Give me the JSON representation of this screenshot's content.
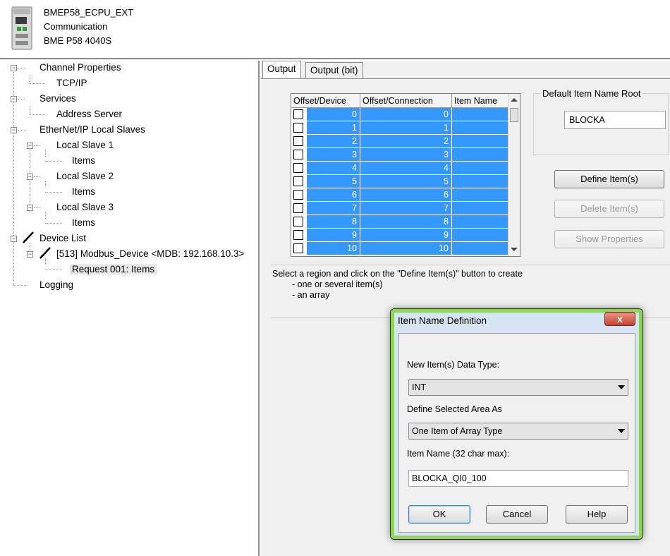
{
  "header": {
    "device_name": "BMEP58_ECPU_EXT",
    "category": "Communication",
    "model": "BME P58 4040S"
  },
  "tree": {
    "channel_properties": "Channel Properties",
    "tcpip": "TCP/IP",
    "services": "Services",
    "address_server": "Address Server",
    "local_slaves": "EtherNet/IP Local Slaves",
    "local_slave_1": "Local Slave 1",
    "local_slave_2": "Local Slave 2",
    "local_slave_3": "Local Slave 3",
    "items": "Items",
    "device_list": "Device List",
    "modbus_device": "[513] Modbus_Device <MDB: 192.168.10.3>",
    "request": "Request 001: Items",
    "logging": "Logging",
    "expand_glyph": "−"
  },
  "tabs": [
    "Output",
    "Output (bit)"
  ],
  "grid": {
    "columns": [
      "Offset/Device",
      "Offset/Connection",
      "Item Name"
    ],
    "rows": [
      {
        "device": "0",
        "connection": "0"
      },
      {
        "device": "1",
        "connection": "1"
      },
      {
        "device": "2",
        "connection": "2"
      },
      {
        "device": "3",
        "connection": "3"
      },
      {
        "device": "4",
        "connection": "4"
      },
      {
        "device": "5",
        "connection": "5"
      },
      {
        "device": "6",
        "connection": "6"
      },
      {
        "device": "7",
        "connection": "7"
      },
      {
        "device": "8",
        "connection": "8"
      },
      {
        "device": "9",
        "connection": "9"
      },
      {
        "device": "10",
        "connection": "10"
      }
    ],
    "selection_color": "#3399ff"
  },
  "root": {
    "label": "Default Item Name Root",
    "value": "BLOCKA"
  },
  "buttons": {
    "define": "Define Item(s)",
    "delete": "Delete Item(s)",
    "show_properties": "Show Properties"
  },
  "instructions": {
    "line1": "Select a region and click on the \"Define Item(s)\" button to create",
    "line2": "- one or several item(s)",
    "line3": "- an array"
  },
  "dialog": {
    "title": "Item Name Definition",
    "close_glyph": "x",
    "data_type_label": "New Item(s) Data Type:",
    "data_type_value": "INT",
    "area_label": "Define Selected Area As",
    "area_value": "One Item of Array Type",
    "item_name_label": "Item Name (32 char max):",
    "item_name_value": "BLOCKA_QI0_100",
    "ok": "OK",
    "cancel": "Cancel",
    "help": "Help"
  }
}
